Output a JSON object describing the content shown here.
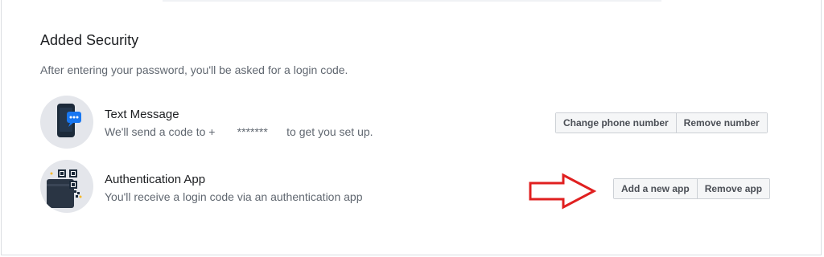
{
  "section": {
    "title": "Added Security",
    "subtitle": "After entering your password, you'll be asked for a login code."
  },
  "methods": [
    {
      "title": "Text Message",
      "description": "We'll send a code to +       *******      to get you set up.",
      "icon": "phone-message-icon",
      "buttons": [
        "Change phone number",
        "Remove number"
      ]
    },
    {
      "title": "Authentication App",
      "description": "You'll receive a login code via an authentication app",
      "icon": "qr-code-wallet-icon",
      "buttons": [
        "Add a new app",
        "Remove app"
      ]
    }
  ],
  "annotation": {
    "icon": "red-arrow-icon",
    "color": "#e02020"
  },
  "colors": {
    "accent": "#1877f2",
    "text": "#1c1e21",
    "muted": "#606770"
  }
}
